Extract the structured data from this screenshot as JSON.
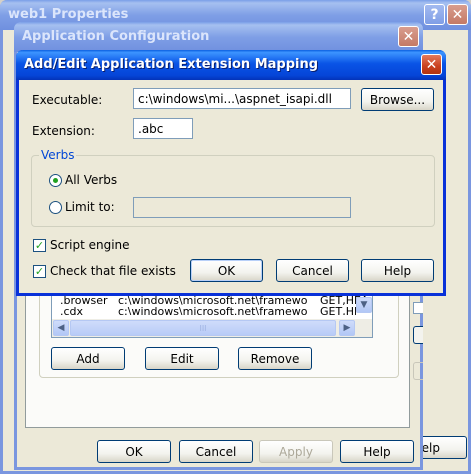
{
  "back_window": {
    "title": "web1 Properties",
    "help_button_label": "elp"
  },
  "app_config": {
    "title": "Application Configuration",
    "list_rows": [
      {
        "ext": ".browser",
        "path": "c:\\windows\\microsoft.net\\framework\\...",
        "verbs": "GET,HEA..."
      },
      {
        "ext": ".cdx",
        "path": "c:\\windows\\microsoft.net\\framework\\...",
        "verbs": "GET,HEA..."
      }
    ],
    "scroll_thumb": "III",
    "add_label": "Add",
    "edit_label": "Edit",
    "remove_label": "Remove",
    "ok_label": "OK",
    "cancel_label": "Cancel",
    "apply_label": "Apply",
    "help_label": "Help"
  },
  "dialog": {
    "title": "Add/Edit Application Extension Mapping",
    "executable_label": "Executable:",
    "executable_value": "c:\\windows\\mi...\\aspnet_isapi.dll",
    "browse_label": "Browse...",
    "extension_label": "Extension:",
    "extension_value": ".abc",
    "verbs_group_label": "Verbs",
    "all_verbs_label": "All Verbs",
    "all_verbs_selected": true,
    "limit_to_label": "Limit to:",
    "limit_to_value": "",
    "script_engine_label": "Script engine",
    "script_engine_checked": true,
    "check_file_label": "Check that file exists",
    "check_file_checked": true,
    "ok_label": "OK",
    "cancel_label": "Cancel",
    "help_label": "Help"
  },
  "colors": {
    "active_title": "#0a54e6",
    "inactive_title": "#7f9fe6",
    "xp_face": "#ece9d8",
    "check_green": "#21a121"
  }
}
